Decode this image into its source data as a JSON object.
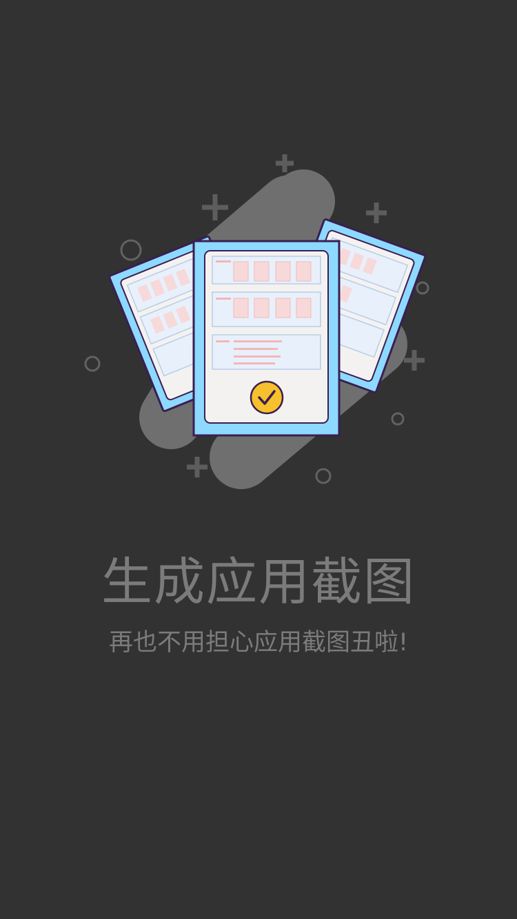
{
  "onboarding": {
    "title": "生成应用截图",
    "subtitle": "再也不用担心应用截图丑啦!"
  },
  "colors": {
    "background": "#323232",
    "text": "#7b7b7b",
    "blob": "#6f6f6f",
    "decoration": "#5d5d5d",
    "card_frame": "#8dd9ff",
    "card_outline": "#3a1e52",
    "card_paper": "#f4f2f1",
    "card_panel": "#e8f0fb",
    "card_tile": "#f7d9d9",
    "check_badge": "#f6c12c"
  },
  "icons": {
    "main": "screenshot-documents-icon",
    "badge": "check-icon"
  }
}
